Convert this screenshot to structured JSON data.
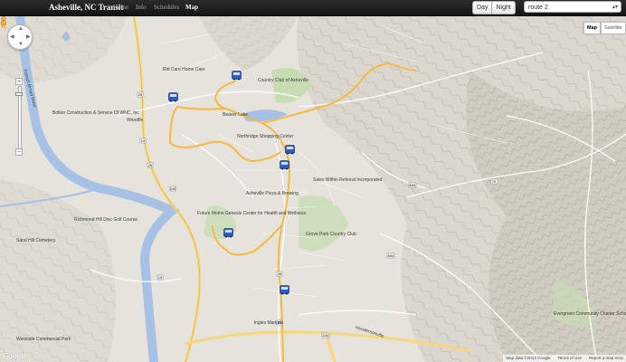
{
  "navbar": {
    "brand": "Asheville, NC Transit",
    "items": [
      {
        "label": "Home"
      },
      {
        "label": "Info"
      },
      {
        "label": "Schedules"
      },
      {
        "label": "Map"
      }
    ],
    "active": "Map",
    "day_label": "Day",
    "night_label": "Night",
    "route_select": "route 2"
  },
  "map": {
    "type_map": "Map",
    "type_satellite": "Satellite",
    "attribution": "Map data ©2013 Google",
    "terms": "Terms of Use",
    "report": "Report a map error",
    "logo": "Google",
    "colors": {
      "route": "#f5b942",
      "river": "#a7c1e4",
      "road": "#ffffff",
      "highway": "#f7d77a",
      "park": "#c8dcb4"
    },
    "labels": {
      "french_broad": "French Broad River",
      "bolton": "Bolton Construction & Service Of WNC, Inc",
      "woodfin": "Woodfin",
      "ridgecare": "Rid Care Home Care",
      "country_club": "Country Club of Asheville",
      "beaver_lake": "Beaver Lake",
      "northridge": "Northridge Shopping Center",
      "asheville_pizza": "Asheville Pizza & Brewing",
      "future_moms": "Future Moms Genesis Center for Health and Wellness",
      "richmond_hill": "Richmond Hill Disc Golf Course",
      "sand_hill": "Sand Hill Cemetery",
      "sales_incorporated": "Sales Within Referral Incorporated",
      "grove_park": "Grove Park Country Club",
      "ingles": "Ingles Markets",
      "westside": "Westside Commercial Park",
      "evergreen": "Evergreen Community Charter School",
      "hendersonville": "Hendersonville"
    }
  }
}
